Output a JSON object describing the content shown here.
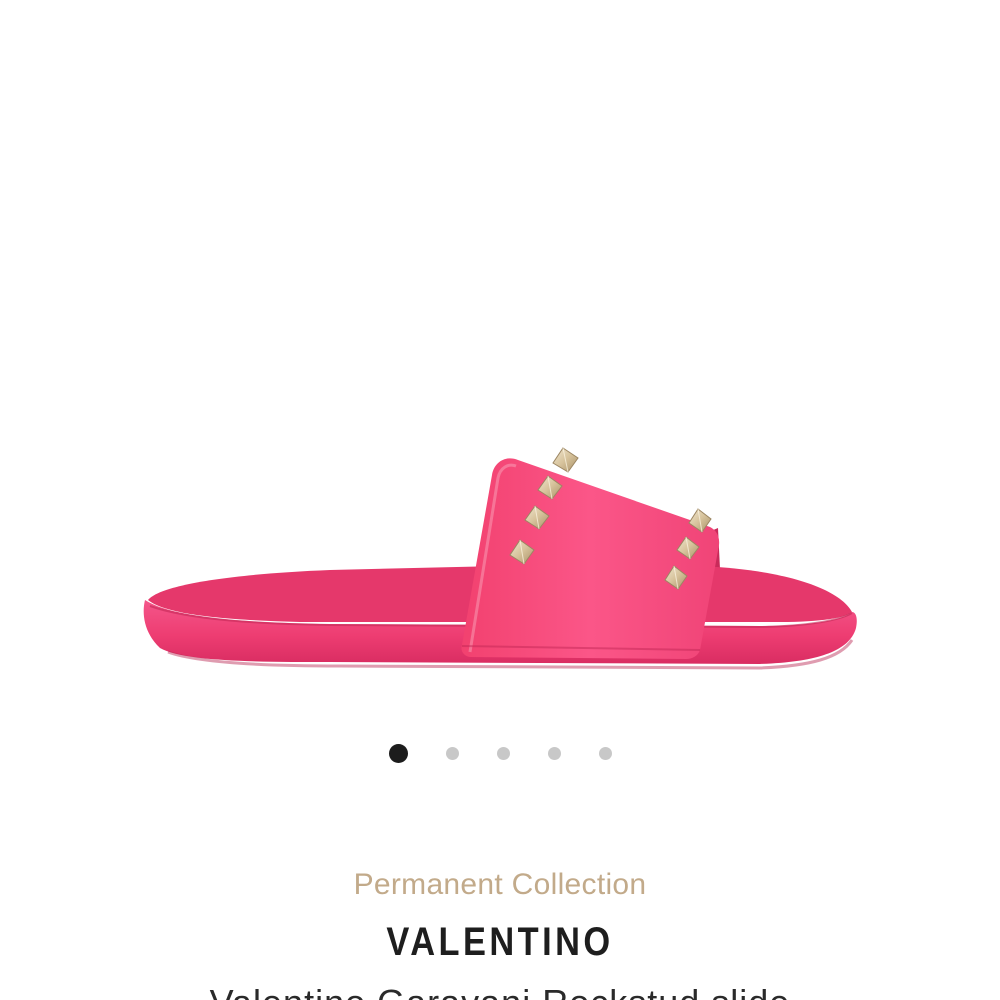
{
  "product": {
    "collection": "Permanent Collection",
    "brand": "VALENTINO",
    "title": "Valentino Garavani Rockstud slide"
  },
  "gallery": {
    "image_description": "pink-rockstud-slide",
    "slide_count": 5,
    "active_slide": 1
  },
  "colors": {
    "sandal_pink": "#f23f74",
    "stud_gold": "#d8c6a0",
    "collection_label": "#c2aa8a",
    "dot_active": "#1c1c1c",
    "dot_inactive": "#c8c8c8"
  }
}
